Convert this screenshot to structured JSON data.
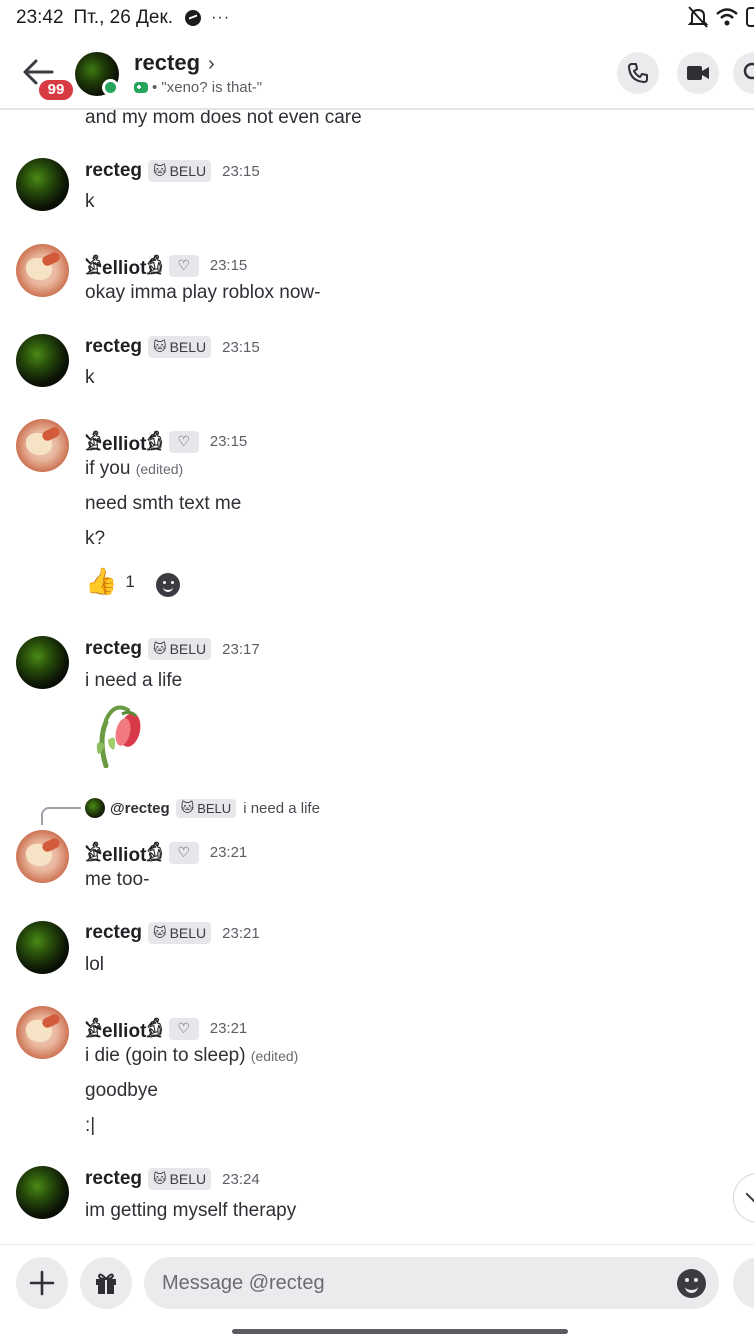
{
  "status_bar": {
    "time": "23:42",
    "date": "Пт., 26 Дек.",
    "more": "···"
  },
  "header": {
    "unread_count": "99",
    "name": "recteg",
    "chevron": "›",
    "activity": "• \"xeno? is that-\""
  },
  "messages": {
    "top_partial": "and my mom does not even care",
    "tag_label": "BELU",
    "edited_label": "(edited)",
    "groups": [
      {
        "user": "recteg",
        "time": "23:15",
        "lines": [
          "k"
        ]
      },
      {
        "user": "𓀀elliot𓀁",
        "time": "23:15",
        "lines": [
          "okay imma play roblox now-"
        ]
      },
      {
        "user": "recteg",
        "time": "23:15",
        "lines": [
          "k"
        ]
      },
      {
        "user": "𓀀elliot𓀁",
        "time": "23:15",
        "lines": [
          "if you",
          "need smth text me",
          "k?"
        ]
      },
      {
        "user": "recteg",
        "time": "23:17",
        "lines": [
          "i need a life"
        ]
      },
      {
        "user": "𓀀elliot𓀁",
        "time": "23:21",
        "lines": [
          "me too-"
        ]
      },
      {
        "user": "recteg",
        "time": "23:21",
        "lines": [
          "lol"
        ]
      },
      {
        "user": "𓀀elliot𓀁",
        "time": "23:21",
        "lines": [
          "i die (goin to sleep)",
          "goodbye",
          ":|"
        ]
      },
      {
        "user": "recteg",
        "time": "23:24",
        "lines": [
          "im getting myself therapy"
        ]
      }
    ],
    "reaction": {
      "emoji": "👍",
      "count": "1"
    },
    "reply": {
      "mention": "@recteg",
      "text": "i need a life"
    }
  },
  "composer": {
    "placeholder": "Message @recteg"
  }
}
